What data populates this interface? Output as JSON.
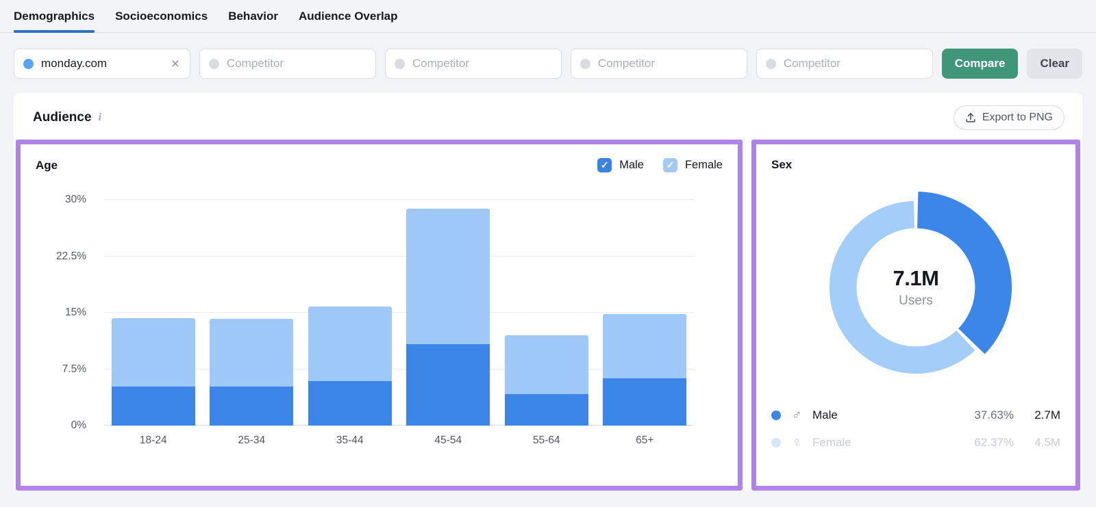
{
  "tabs": {
    "items": [
      {
        "label": "Demographics",
        "active": true
      },
      {
        "label": "Socioeconomics",
        "active": false
      },
      {
        "label": "Behavior",
        "active": false
      },
      {
        "label": "Audience Overlap",
        "active": false
      }
    ]
  },
  "filters": {
    "selected_domain": "monday.com",
    "selected_dot_color": "#58a6f2",
    "remove_icon": "×",
    "competitor_placeholder": "Competitor",
    "competitor_count": 4,
    "compare_label": "Compare",
    "clear_label": "Clear"
  },
  "audience_card": {
    "title": "Audience",
    "info_icon": "i",
    "export_label": "Export to PNG"
  },
  "colors": {
    "male_blue": "#3c86e9",
    "female_light_blue": "#9dc8f8",
    "male_checkbox": "#3c83e1",
    "female_checkbox": "#a6c9f4",
    "donut_male": "#3c86e9",
    "donut_female": "#a4cdf9",
    "compare_green": "#3f9678",
    "panel_purple": "#b083e8",
    "tab_underline": "#3070c0"
  },
  "chart_data": [
    {
      "type": "bar",
      "title": "Age",
      "stacked": true,
      "categories": [
        "18-24",
        "25-34",
        "35-44",
        "45-54",
        "55-64",
        "65+"
      ],
      "series": [
        {
          "name": "Male",
          "color": "#3c86e9",
          "checkbox_color": "#3c83e1",
          "checked": true,
          "values": [
            5.2,
            5.2,
            5.9,
            10.8,
            4.2,
            6.3
          ]
        },
        {
          "name": "Female",
          "color": "#9dc8f8",
          "checkbox_color": "#a6c9f4",
          "checked": true,
          "values": [
            9.1,
            9.0,
            9.9,
            18.0,
            7.8,
            8.5
          ]
        }
      ],
      "xlabel": "",
      "ylabel": "",
      "ylim": [
        0,
        30
      ],
      "yticks": [
        {
          "value": 0,
          "label": "0%"
        },
        {
          "value": 7.5,
          "label": "7.5%"
        },
        {
          "value": 15,
          "label": "15%"
        },
        {
          "value": 22.5,
          "label": "22.5%"
        },
        {
          "value": 30,
          "label": "30%"
        }
      ],
      "grid": true,
      "legend_position": "top-right"
    },
    {
      "type": "donut",
      "title": "Sex",
      "center_value": "7.1M",
      "center_label": "Users",
      "slices": [
        {
          "name": "Male",
          "pct": 37.63,
          "value": "2.7M",
          "color": "#3c86e9",
          "icon": "♂",
          "state": "highlighted"
        },
        {
          "name": "Female",
          "pct": 62.37,
          "value": "4.5M",
          "color": "#a4cdf9",
          "icon": "♀",
          "state": "dimmed"
        }
      ],
      "legend_position": "bottom"
    }
  ],
  "glyphs": {
    "checkmark": "✓"
  }
}
